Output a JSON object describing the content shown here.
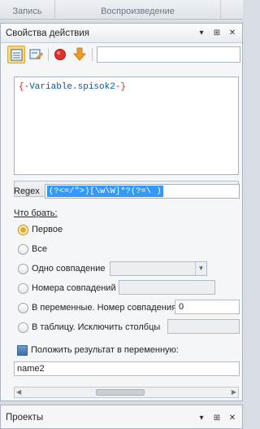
{
  "top_tabs": [
    "Запись",
    "Воспроизведение"
  ],
  "panel": {
    "title": "Свойства действия",
    "controls": [
      "▾",
      "⊞",
      "✕"
    ]
  },
  "toolbar": {
    "buttons": [
      "list-view-icon",
      "edit-icon",
      "record-icon",
      "arrow-down-icon"
    ],
    "input_value": ""
  },
  "code": {
    "open": "{-",
    "variable": "Variable.spisok2",
    "close": "-}"
  },
  "regex_section": {
    "header": "Regex",
    "label": "Regex",
    "value": "(?<=/\">)[\\w\\W]*?(?=\\ )"
  },
  "what_to_take": {
    "label": "Что брать:",
    "options": [
      {
        "label": "Первое",
        "selected": true
      },
      {
        "label": "Все",
        "selected": false
      },
      {
        "label": "Одно совпадение",
        "selected": false
      },
      {
        "label": "Номера совпадений",
        "selected": false
      },
      {
        "label": "В переменные. Номер совпадения",
        "selected": false,
        "value": "0"
      },
      {
        "label": "В таблицу. Исключить столбцы",
        "selected": false
      }
    ]
  },
  "result": {
    "checkbox_label": "Положить результат в переменную:",
    "checked": true,
    "variable": "name2"
  },
  "projects": {
    "title": "Проекты",
    "controls": [
      "▾",
      "⊞",
      "✕"
    ]
  },
  "colors": {
    "selection": "#3399ff",
    "accent": "#f6d77b",
    "code_bracket": "#d21a1a",
    "code_var": "#0a58a6"
  }
}
